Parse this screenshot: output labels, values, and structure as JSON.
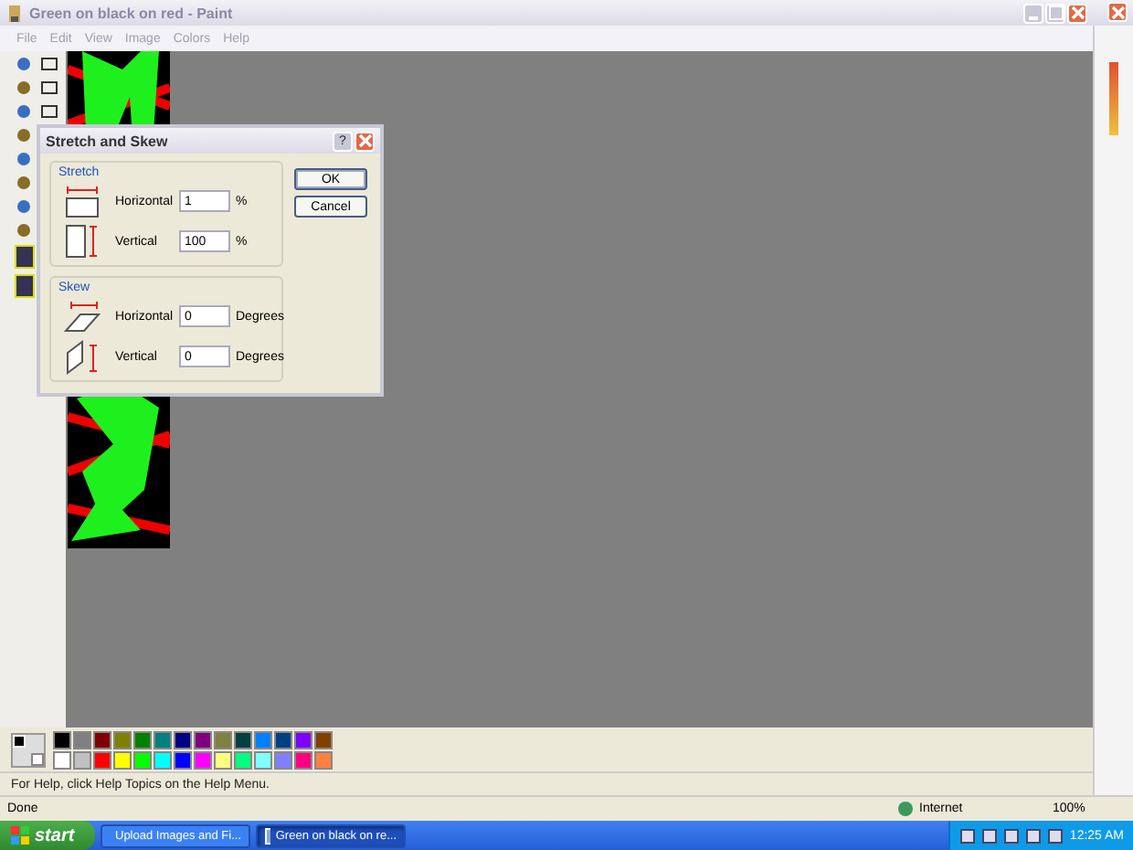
{
  "window": {
    "title": "Green on black on red - Paint"
  },
  "menu": [
    "File",
    "Edit",
    "View",
    "Image",
    "Colors",
    "Help"
  ],
  "dialog": {
    "title": "Stretch and Skew",
    "help": "?",
    "sections": [
      {
        "title": "Stretch",
        "kind": "stretch",
        "rows": [
          {
            "label": "Horizontal",
            "value": "1",
            "unit": "%",
            "kind": "horizontal"
          },
          {
            "label": "Vertical",
            "value": "100",
            "unit": "%",
            "kind": "vertical"
          }
        ]
      },
      {
        "title": "Skew",
        "kind": "skew",
        "rows": [
          {
            "label": "Horizontal",
            "value": "0",
            "unit": "Degrees",
            "kind": "horizontal"
          },
          {
            "label": "Vertical",
            "value": "0",
            "unit": "Degrees",
            "kind": "vertical"
          }
        ]
      }
    ],
    "buttons": [
      {
        "label": "OK",
        "selected": true
      },
      {
        "label": "Cancel",
        "selected": false
      }
    ]
  },
  "palette": {
    "current": [
      {
        "color": "#000000"
      },
      {
        "color": "#ffffff"
      }
    ],
    "colors": [
      {
        "color": "#000000"
      },
      {
        "color": "#ffffff"
      },
      {
        "color": "#808080"
      },
      {
        "color": "#c0c0c0"
      },
      {
        "color": "#800000"
      },
      {
        "color": "#ff0000"
      },
      {
        "color": "#808000"
      },
      {
        "color": "#ffff00"
      },
      {
        "color": "#008000"
      },
      {
        "color": "#00ff00"
      },
      {
        "color": "#008080"
      },
      {
        "color": "#00ffff"
      },
      {
        "color": "#000080"
      },
      {
        "color": "#0000ff"
      },
      {
        "color": "#800080"
      },
      {
        "color": "#ff00ff"
      },
      {
        "color": "#808040"
      },
      {
        "color": "#ffff80"
      },
      {
        "color": "#004040"
      },
      {
        "color": "#00ff80"
      },
      {
        "color": "#0080ff"
      },
      {
        "color": "#80ffff"
      },
      {
        "color": "#004080"
      },
      {
        "color": "#8080ff"
      },
      {
        "color": "#8000ff"
      },
      {
        "color": "#ff0080"
      },
      {
        "color": "#804000"
      },
      {
        "color": "#ff8040"
      }
    ]
  },
  "status_bar": "For Help, click Help Topics on the Help Menu.",
  "browser_status": {
    "text": "Done",
    "zone": "Internet",
    "zoom": "100%"
  },
  "taskbar": {
    "start": "start",
    "tasks": [
      {
        "label": "Upload Images and Fi...",
        "selected": false
      },
      {
        "label": "Green on black on re...",
        "selected": true
      }
    ],
    "clock": "12:25 AM"
  }
}
